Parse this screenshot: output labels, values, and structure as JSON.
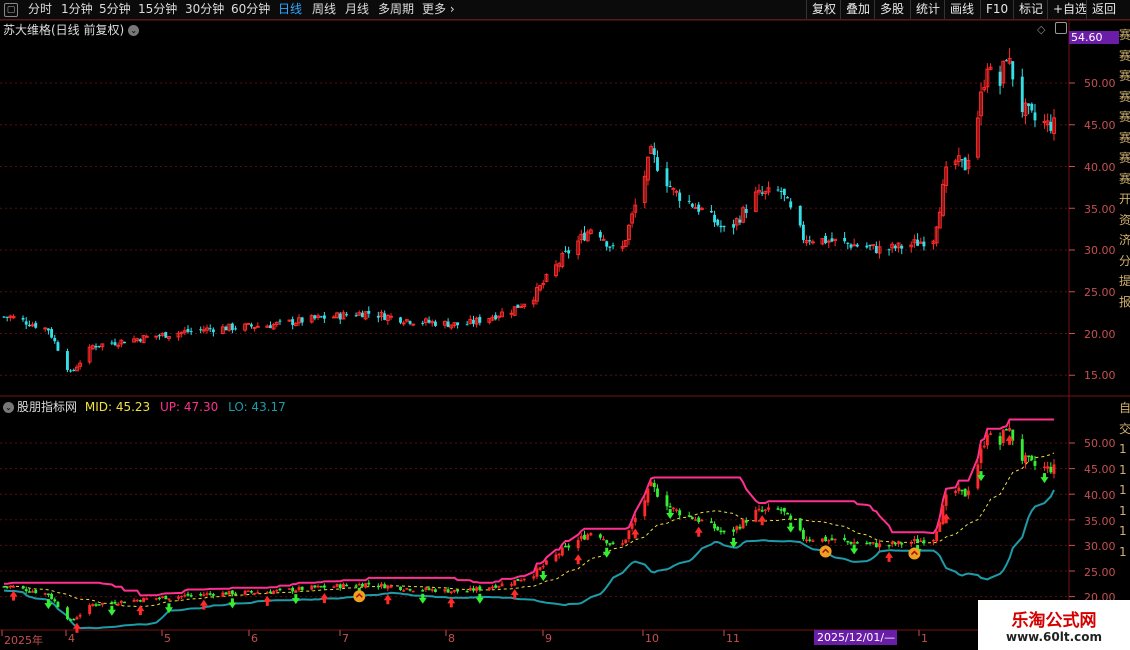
{
  "toolbar": {
    "periods": [
      "分时",
      "1分钟",
      "5分钟",
      "15分钟",
      "30分钟",
      "60分钟",
      "日线",
      "周线",
      "月线",
      "多周期",
      "更多"
    ],
    "active_period": "日线",
    "right_buttons": [
      "复权",
      "叠加",
      "多股",
      "统计",
      "画线",
      "F10",
      "标记",
      "+自选",
      "返回"
    ]
  },
  "main_chart": {
    "title": "苏大维格(日线 前复权)",
    "last_price_badge": "54.60",
    "y_ticks": [
      "50.00",
      "45.00",
      "40.00",
      "35.00",
      "30.00",
      "25.00",
      "20.00",
      "15.00"
    ]
  },
  "indicator": {
    "name": "股朋指标网",
    "mid_label": "MID: 45.23",
    "up_label": "UP: 47.30",
    "lo_label": "LO: 43.17",
    "y_ticks": [
      "50.00",
      "45.00",
      "40.00",
      "35.00",
      "30.00",
      "25.00",
      "20.00"
    ]
  },
  "x_axis": {
    "labels": [
      "2025年",
      "4",
      "5",
      "6",
      "7",
      "8",
      "9",
      "10",
      "11",
      "1"
    ],
    "cursor_date": "2025/12/01/—"
  },
  "right_strip": {
    "top_chars": "赛赛赛赛赛赛赛赛开资济分提报",
    "bottom_chars": "自交111111"
  },
  "watermark": {
    "name": "乐淘公式网",
    "url": "www.60lt.com"
  },
  "colors": {
    "up": "#ff2a2a",
    "down": "#33e0e8",
    "mid": "#f0e040",
    "upper": "#ff3090",
    "lower": "#1d9ba8",
    "ind_down": "#33ee33",
    "axis": "#c65050"
  },
  "chart_data": {
    "type": "candlestick",
    "series_summary": "daily close, 2025-03 to 2026-01",
    "close_anchors": [
      [
        "2025-03-20",
        22.0
      ],
      [
        "2025-04-01",
        20.5
      ],
      [
        "2025-04-08",
        15.2
      ],
      [
        "2025-04-15",
        18.5
      ],
      [
        "2025-05-01",
        19.5
      ],
      [
        "2025-05-20",
        20.5
      ],
      [
        "2025-06-10",
        21.0
      ],
      [
        "2025-06-25",
        21.8
      ],
      [
        "2025-07-10",
        22.5
      ],
      [
        "2025-07-25",
        21.5
      ],
      [
        "2025-08-10",
        21.0
      ],
      [
        "2025-08-25",
        22.8
      ],
      [
        "2025-09-01",
        24.5
      ],
      [
        "2025-09-10",
        29.0
      ],
      [
        "2025-09-20",
        33.0
      ],
      [
        "2025-09-28",
        29.0
      ],
      [
        "2025-10-08",
        41.5
      ],
      [
        "2025-10-15",
        37.0
      ],
      [
        "2025-10-25",
        34.5
      ],
      [
        "2025-11-01",
        32.0
      ],
      [
        "2025-11-10",
        36.5
      ],
      [
        "2025-11-18",
        37.0
      ],
      [
        "2025-11-25",
        31.5
      ],
      [
        "2025-12-05",
        31.0
      ],
      [
        "2025-12-20",
        30.0
      ],
      [
        "2025-12-28",
        30.5
      ],
      [
        "2026-01-05",
        31.5
      ],
      [
        "2026-01-10",
        41.0
      ],
      [
        "2026-01-15",
        40.0
      ],
      [
        "2026-01-18",
        44.0
      ],
      [
        "2026-01-22",
        52.5
      ],
      [
        "2026-01-25",
        48.0
      ],
      [
        "2026-01-28",
        53.5
      ],
      [
        "2026-02-02",
        47.0
      ],
      [
        "2026-02-06",
        45.5
      ],
      [
        "2026-02-10",
        45.0
      ]
    ],
    "indicator_last": {
      "mid": 45.23,
      "up": 47.3,
      "lo": 43.17
    }
  }
}
